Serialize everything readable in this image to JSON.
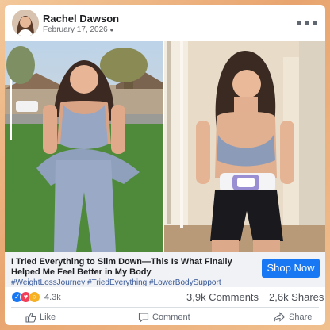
{
  "post": {
    "author": "Rachel Dawson",
    "date": "February 17, 2026",
    "privacy_icon": "globe-icon",
    "more_icon": "ellipsis-icon"
  },
  "ad": {
    "title": "I Tried Everything to Slim Down—This Is What Finally Helped Me Feel Better in My Body",
    "hashtags": "#WeightLossJourney #TriedEverything #LowerBodySupport",
    "cta_label": "Shop Now"
  },
  "stats": {
    "reaction_icons": [
      "like-icon",
      "love-icon",
      "wow-icon"
    ],
    "reactions": "4.3k",
    "comments": "3,9k Comments",
    "shares": "2,6k Shares"
  },
  "actions": {
    "like": "Like",
    "comment": "Comment",
    "share": "Share"
  },
  "colors": {
    "brand": "#1877f2",
    "hashtag": "#385898",
    "frame": "#e9b88a"
  }
}
